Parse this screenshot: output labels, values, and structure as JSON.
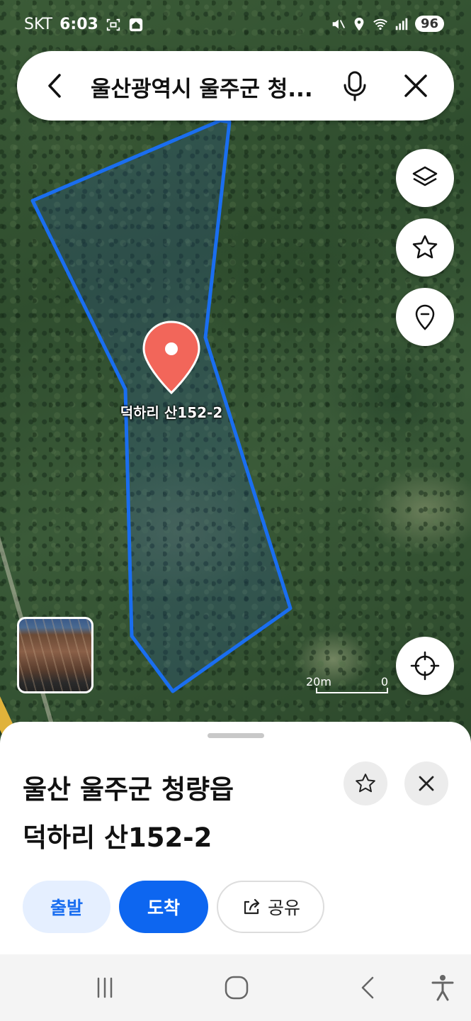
{
  "status_bar": {
    "carrier": "SKT",
    "time": "6:03",
    "battery": "96",
    "icons": [
      "screenshot-icon",
      "home-icon",
      "mute-icon",
      "location-icon",
      "wifi-icon",
      "signal-icon"
    ]
  },
  "search": {
    "query": "울산광역시 울주군 청...",
    "back_icon": "chevron-left-icon",
    "mic_icon": "mic-icon",
    "clear_icon": "close-icon"
  },
  "map": {
    "buttons": [
      "layers-icon",
      "star-icon",
      "pin-icon",
      "locate-icon"
    ],
    "marker_label": "덕하리 산152-2",
    "parcel_color": "#1a6ef0",
    "marker_color": "#f2665a",
    "scale": {
      "left": "20m",
      "right": "0"
    }
  },
  "sheet": {
    "title_line1": "울산 울주군 청량읍",
    "title_line2": "덕하리 산152-2",
    "actions": {
      "depart": "출발",
      "arrive": "도착",
      "share": "공유"
    },
    "accent_color": "#0d66f0"
  },
  "nav_bar": {
    "icons": [
      "recent-apps-icon",
      "home-button-icon",
      "back-icon",
      "accessibility-icon"
    ]
  }
}
